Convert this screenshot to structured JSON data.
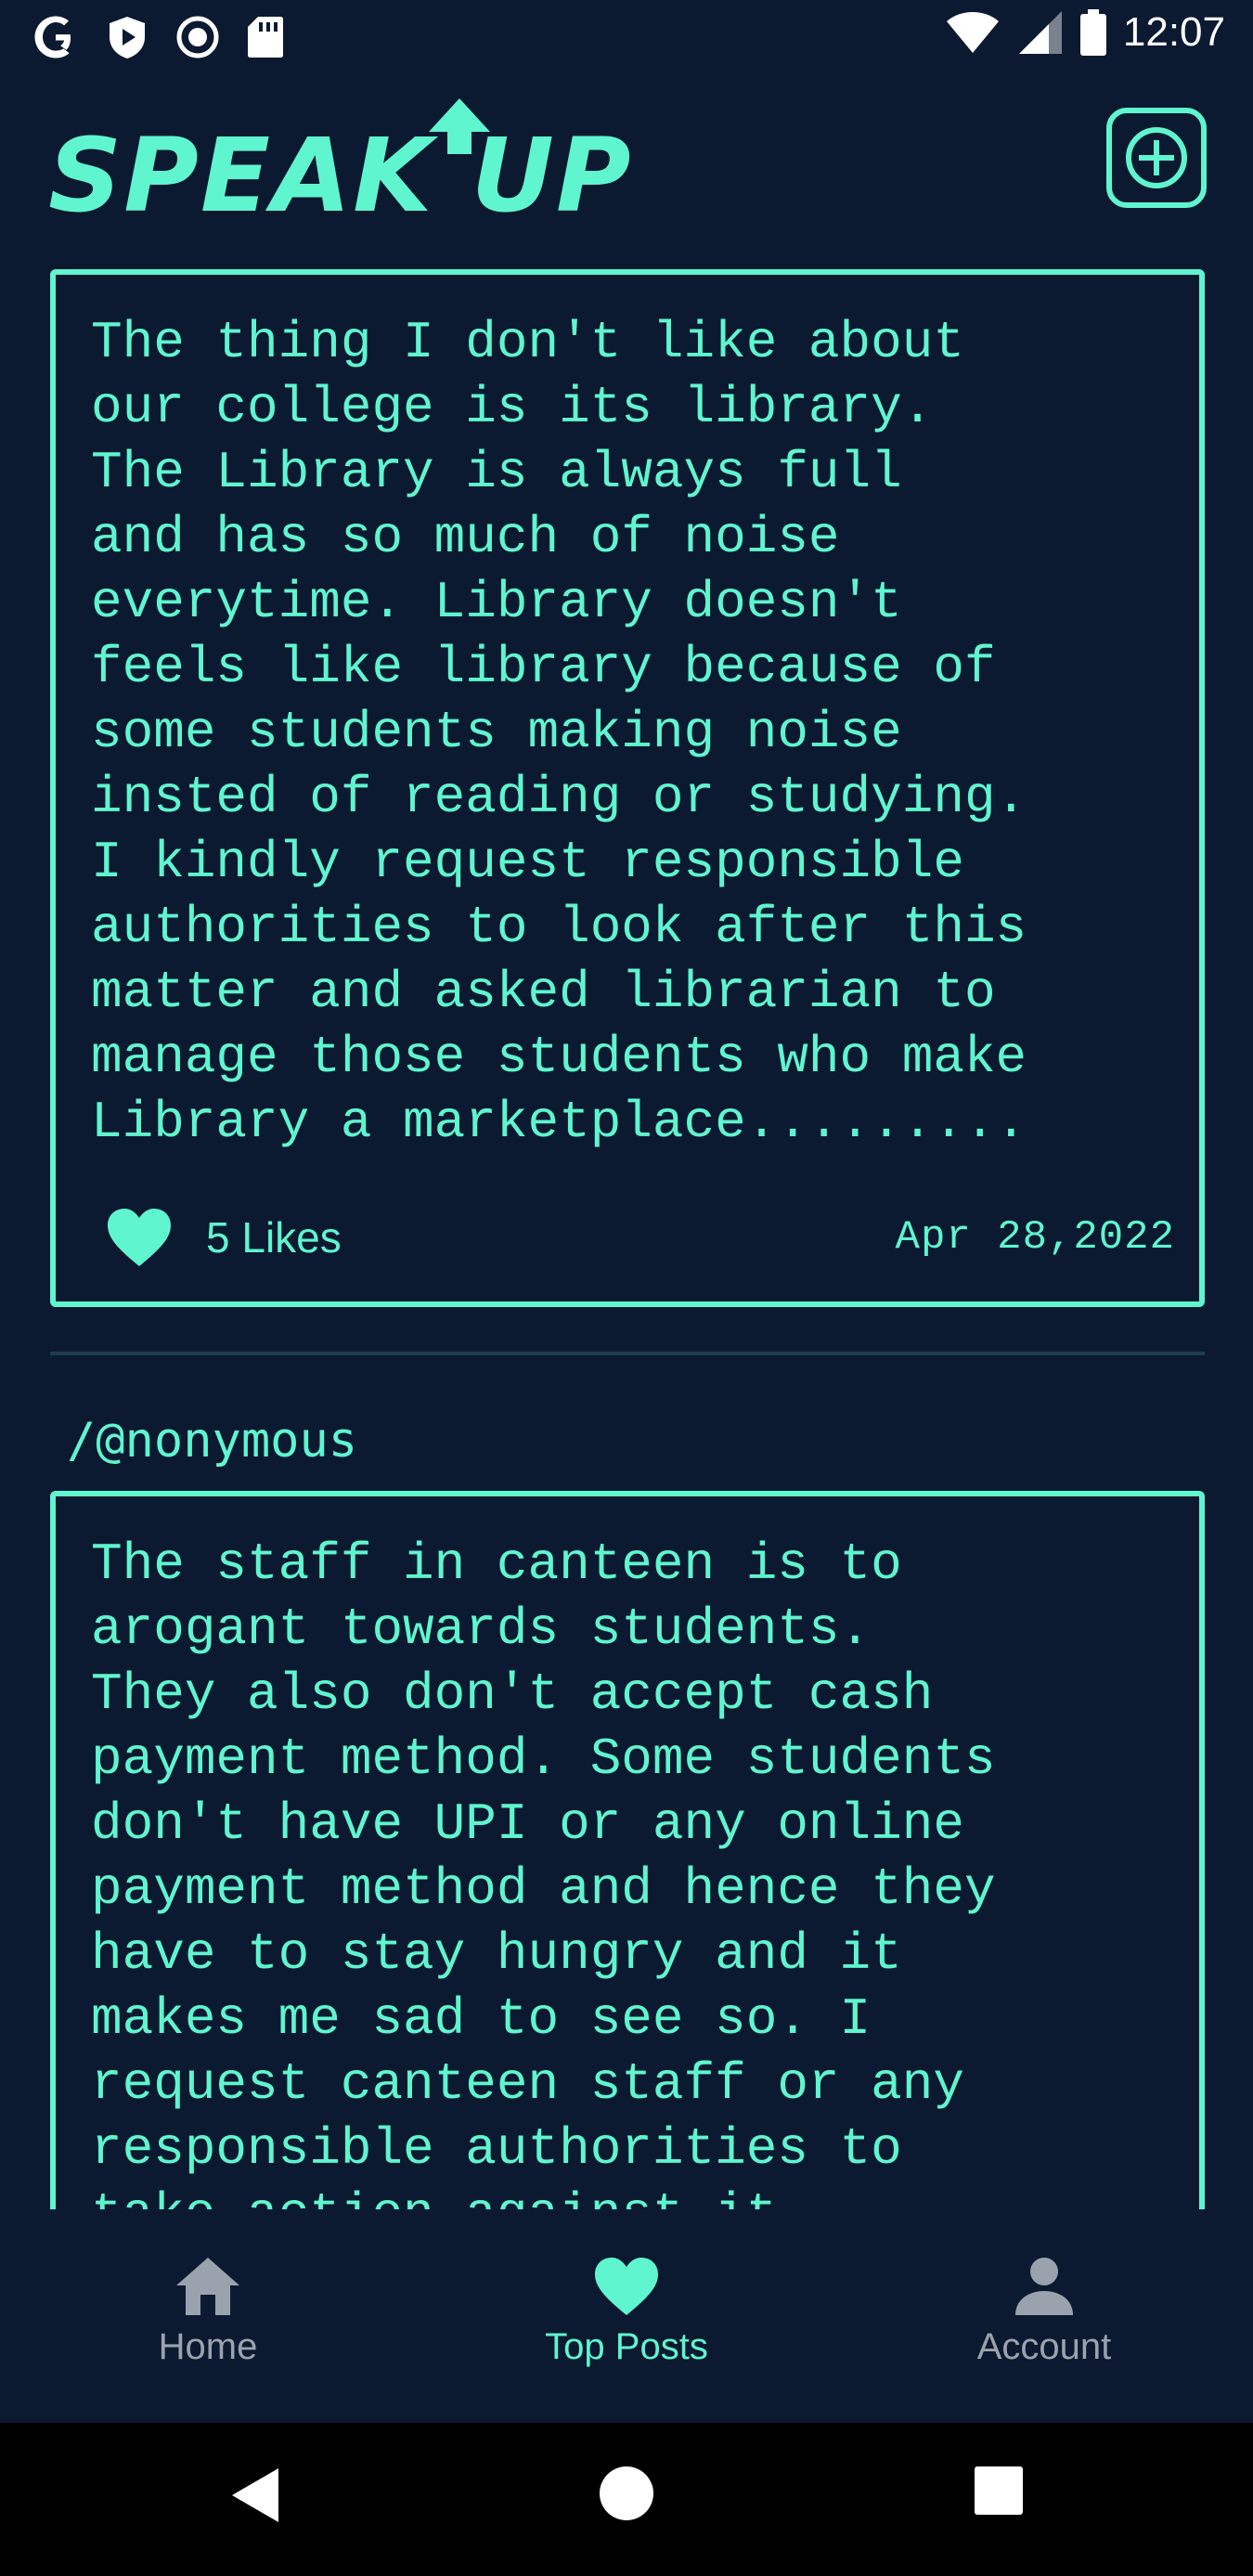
{
  "status_bar": {
    "time": "12:07",
    "left_icons": [
      "google-icon",
      "play-protect-icon",
      "record-icon",
      "sd-card-icon"
    ],
    "right_icons": [
      "wifi-icon",
      "cellular-signal-icon",
      "battery-icon"
    ]
  },
  "header": {
    "logo_text": "SPEAK UP",
    "add_icon": "plus-box-icon"
  },
  "posts": [
    {
      "text": "The thing I don't like about\nour college is its library.\nThe Library is always full\nand has so much of noise\neverytime. Library doesn't\nfeels like library because of\nsome students making noise\ninsted of reading or studying.\nI kindly request responsible\nauthorities to look after this\nmatter and asked librarian to\nmanage those students who make\nLibrary a marketplace.........",
      "likes": "5 Likes",
      "date": "Apr 28,2022"
    },
    {
      "author": "/@nonymous",
      "text": "The staff in canteen is to\narogant towards students.\nThey also don't accept cash\npayment method. Some students\ndon't have UPI or any online\npayment method and hence they\nhave to stay hungry and it\nmakes me sad to see so. I\nrequest canteen staff or any\nresponsible authorities to\ntake action against it."
    }
  ],
  "bottom_nav": {
    "items": [
      {
        "label": "Home",
        "icon": "home-icon",
        "active": false
      },
      {
        "label": "Top Posts",
        "icon": "heart-icon",
        "active": true
      },
      {
        "label": "Account",
        "icon": "person-icon",
        "active": false
      }
    ]
  },
  "colors": {
    "background": "#0b1a30",
    "accent": "#5ff5cf",
    "inactive": "#9aa3ad"
  }
}
